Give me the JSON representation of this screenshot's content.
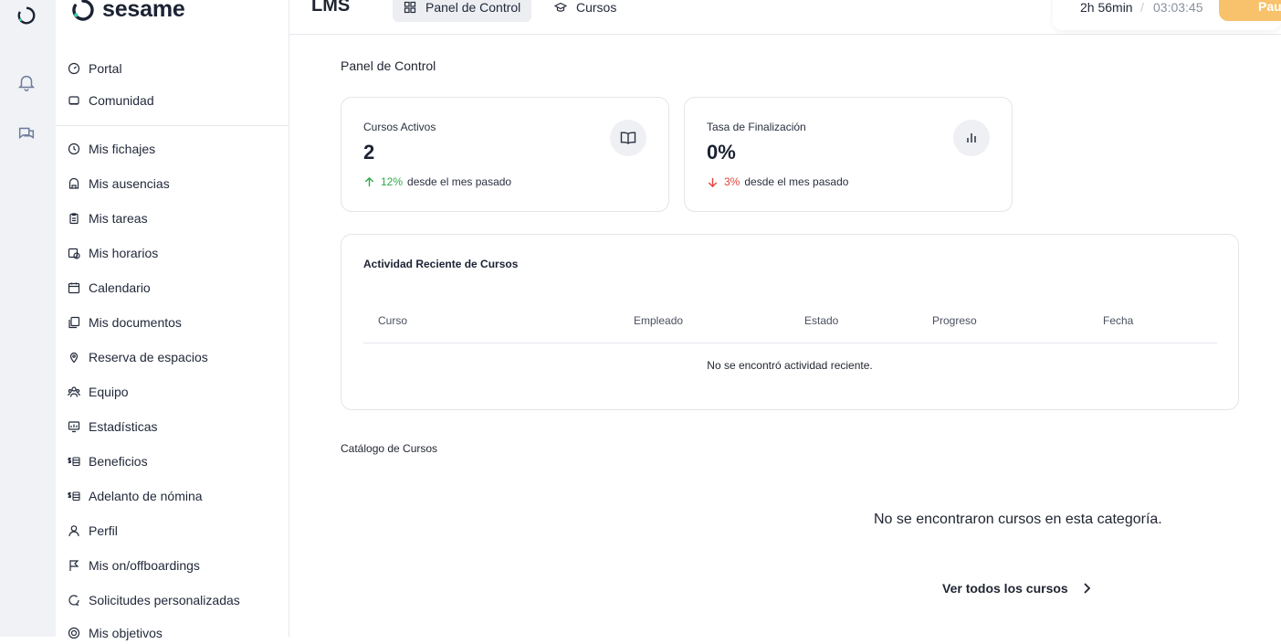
{
  "brand": {
    "name": "sesame"
  },
  "rail": {
    "icons": [
      "logo-icon",
      "bell-icon",
      "chat-icon"
    ]
  },
  "sidebar": {
    "top_items": [
      {
        "label": "Portal",
        "icon": "gauge-icon"
      },
      {
        "label": "Comunidad",
        "icon": "community-icon"
      }
    ],
    "items": [
      {
        "label": "Mis fichajes",
        "icon": "clock-icon"
      },
      {
        "label": "Mis ausencias",
        "icon": "absence-icon"
      },
      {
        "label": "Mis tareas",
        "icon": "clipboard-icon"
      },
      {
        "label": "Mis horarios",
        "icon": "schedule-icon"
      },
      {
        "label": "Calendario",
        "icon": "calendar-icon"
      },
      {
        "label": "Mis documentos",
        "icon": "documents-icon"
      },
      {
        "label": "Reserva de espacios",
        "icon": "pin-icon"
      },
      {
        "label": "Equipo",
        "icon": "team-icon"
      },
      {
        "label": "Estadísticas",
        "icon": "stats-icon"
      },
      {
        "label": "Beneficios",
        "icon": "benefits-icon"
      },
      {
        "label": "Adelanto de nómina",
        "icon": "payroll-icon"
      },
      {
        "label": "Perfil",
        "icon": "user-icon"
      },
      {
        "label": "Mis on/offboardings",
        "icon": "onboarding-icon"
      },
      {
        "label": "Solicitudes personalizadas",
        "icon": "request-icon"
      },
      {
        "label": "Mis objetivos",
        "icon": "target-icon"
      }
    ]
  },
  "topbar": {
    "title": "LMS",
    "tabs": [
      {
        "label": "Panel de Control",
        "icon": "grid-icon",
        "active": true
      },
      {
        "label": "Cursos",
        "icon": "graduation-icon",
        "active": false
      }
    ],
    "timer": {
      "worked": "2h 56min",
      "separator": "/",
      "clock": "03:03:45",
      "pause_label": "Pau"
    }
  },
  "main": {
    "page_title": "Panel de Control",
    "cards": [
      {
        "title": "Cursos Activos",
        "value": "2",
        "trend_value": "12%",
        "trend_dir": "up",
        "trend_text": "desde el mes pasado",
        "icon": "book-icon"
      },
      {
        "title": "Tasa de Finalización",
        "value": "0%",
        "trend_value": "3%",
        "trend_dir": "down",
        "trend_text": "desde el mes pasado",
        "icon": "bar-chart-icon"
      }
    ],
    "activity": {
      "title": "Actividad Reciente de Cursos",
      "columns": [
        "Curso",
        "Empleado",
        "Estado",
        "Progreso",
        "Fecha"
      ],
      "empty_text": "No se encontró actividad reciente."
    },
    "catalog": {
      "title": "Catálogo de Cursos",
      "empty_text": "No se encontraron cursos en esta categoría.",
      "see_all_label": "Ver todos los cursos"
    }
  },
  "colors": {
    "accent_up": "#2faa4a",
    "accent_down": "#e0443e",
    "pause": "#f7c26b"
  }
}
